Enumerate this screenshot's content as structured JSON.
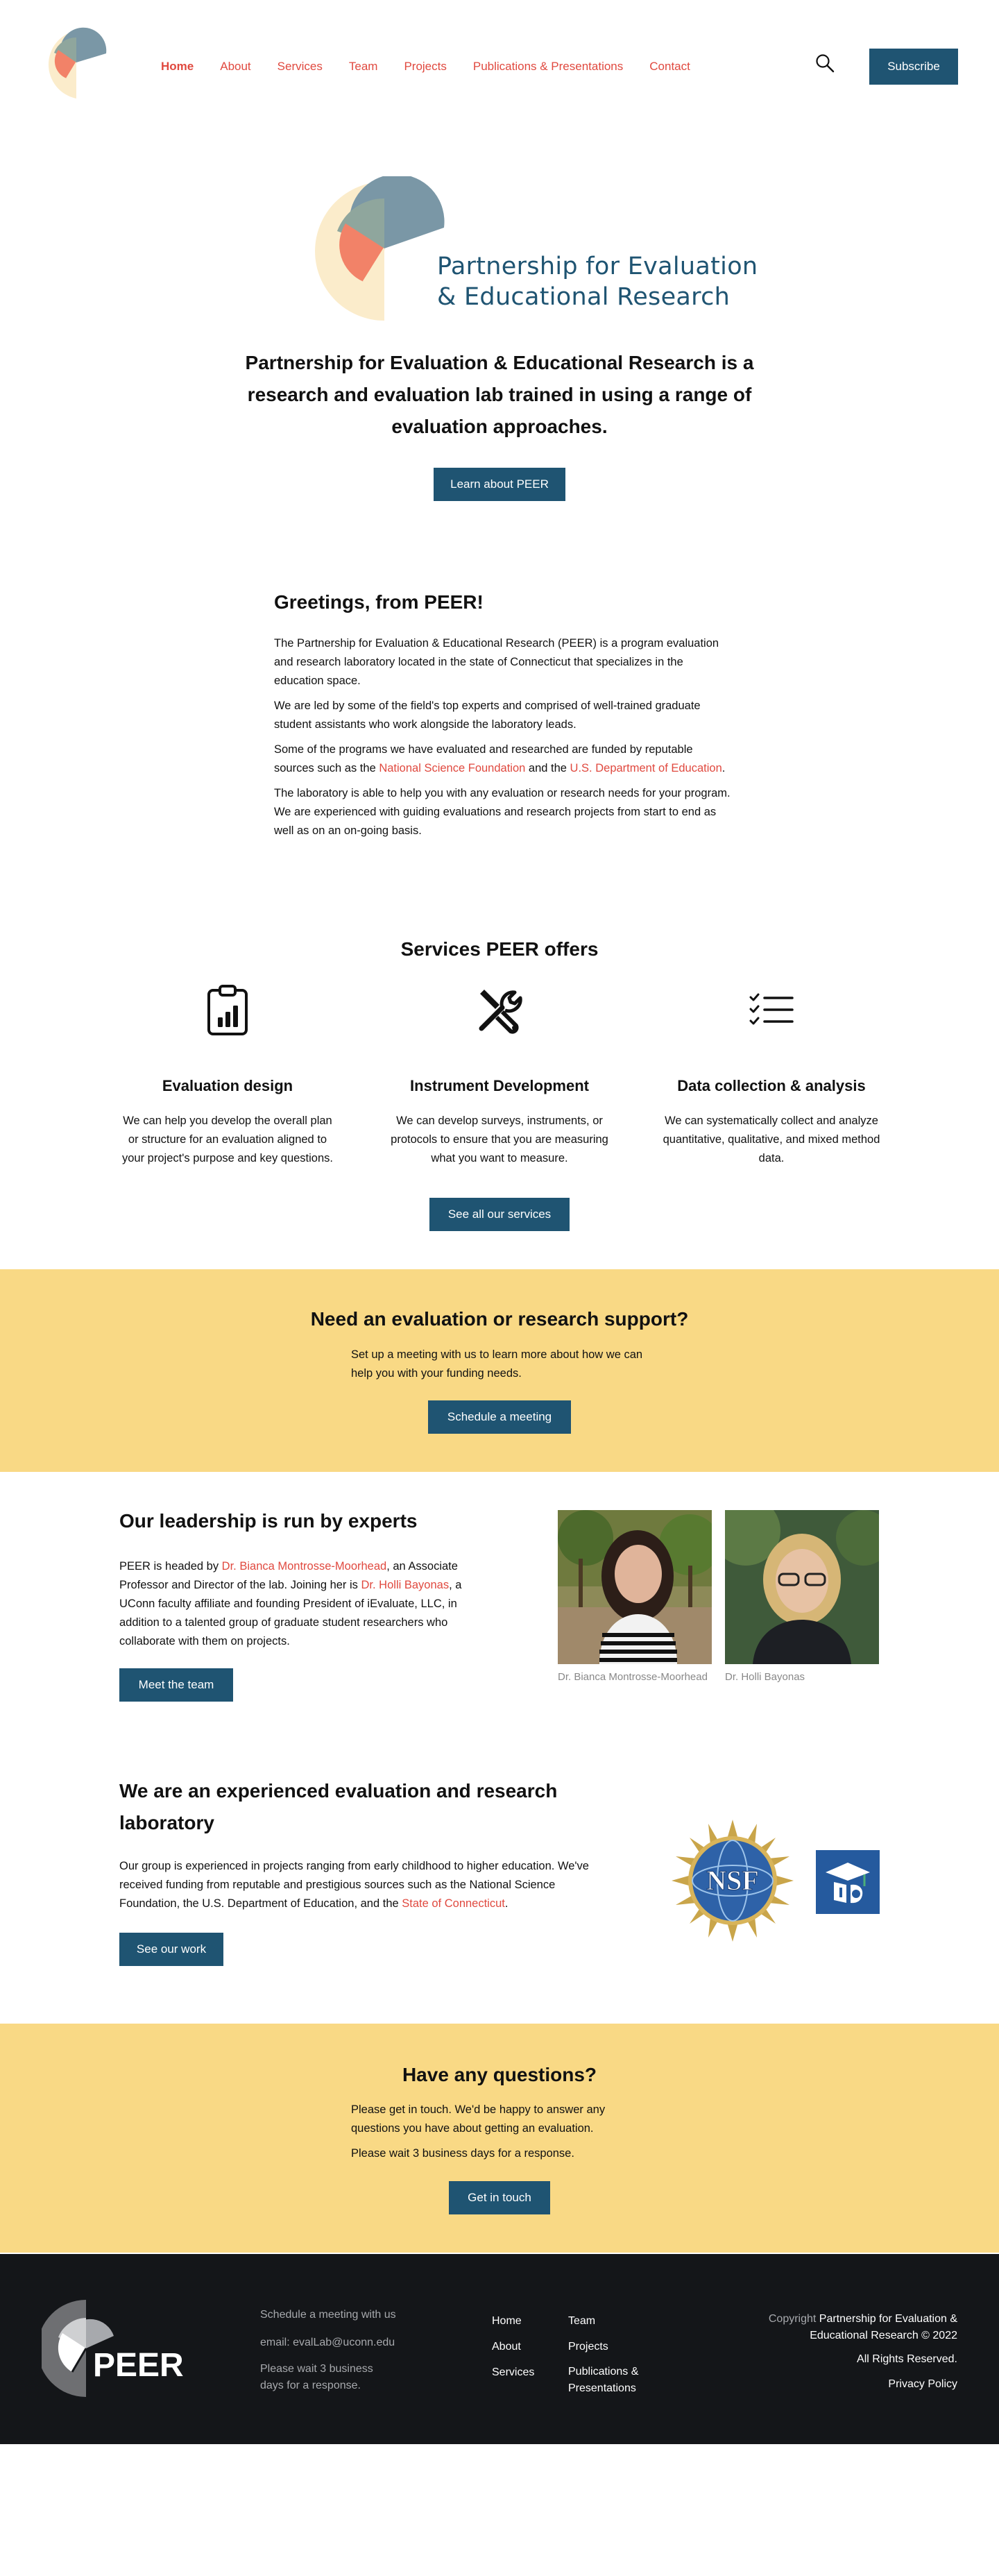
{
  "nav": {
    "items": [
      "Home",
      "About",
      "Services",
      "Team",
      "Projects",
      "Publications & Presentations",
      "Contact"
    ],
    "subscribe": "Subscribe"
  },
  "hero": {
    "brand_line1": "Partnership for Evaluation",
    "brand_line2": "& Educational Research",
    "tagline": "Partnership for Evaluation & Educational Research is a research and evaluation lab trained in using a range of evaluation approaches.",
    "button": "Learn about PEER"
  },
  "greetings": {
    "title": "Greetings, from PEER!",
    "p1": "The Partnership for Evaluation & Educational Research (PEER) is a program evaluation and research laboratory located in the state of Connecticut that specializes in the education space.",
    "p2": "We are led by some of the field's top experts and comprised of well-trained graduate student assistants who work alongside the laboratory leads.",
    "p3_a": "Some of the programs we have evaluated and researched are funded by reputable sources such as the ",
    "p3_link1": "National Science Foundation",
    "p3_b": " and the ",
    "p3_link2": "U.S. Department of Education",
    "p3_c": ".",
    "p4": "The laboratory is able to help you with any evaluation or research needs for your program. We are experienced with guiding evaluations and research projects from start to end as well as on an on-going basis."
  },
  "services": {
    "title": "Services PEER offers",
    "items": [
      {
        "title": "Evaluation design",
        "text": "We can help you develop the overall plan or structure for an evaluation aligned to your project's purpose and key questions.",
        "icon": "clipboard-chart-icon"
      },
      {
        "title": "Instrument Development",
        "text": "We can develop surveys, instruments, or protocols to ensure that you are measuring what you want to measure.",
        "icon": "tools-icon"
      },
      {
        "title": "Data collection & analysis",
        "text": "We can systematically collect and analyze quantitative, qualitative, and mixed method data.",
        "icon": "checklist-icon"
      }
    ],
    "button": "See all our services"
  },
  "cta1": {
    "title": "Need an evaluation or research support?",
    "text": "Set up a meeting with us to learn more about how we can help you with your funding needs.",
    "button": "Schedule a meeting"
  },
  "leadership": {
    "title": "Our leadership is run by experts",
    "p_a": "PEER is headed by ",
    "link1": "Dr. Bianca Montrosse-Moorhead",
    "p_b": ", an Associate Professor and Director of the lab. Joining her is ",
    "link2": "Dr. Holli Bayonas",
    "p_c": ", a UConn faculty affiliate and founding President of iEvaluate, LLC, in addition to a talented group of graduate student researchers who collaborate with them on projects.",
    "button": "Meet the team",
    "captions": [
      "Dr. Bianca Montrosse-Moorhead",
      "Dr. Holli Bayonas"
    ]
  },
  "experience": {
    "title": "We are an experienced evaluation and research laboratory",
    "p_a": "Our group is experienced in projects ranging from early childhood to higher education. We've received funding from reputable and prestigious sources such as the National Science Foundation, the U.S. Department of Education, and the ",
    "link": "State of Connecticut",
    "p_b": ".",
    "button": "See our work",
    "nsf_label": "NSF"
  },
  "cta2": {
    "title": "Have any questions?",
    "text1": "Please get in touch. We'd be happy to answer any questions you have about getting an evaluation.",
    "text2": "Please wait 3 business days for a response.",
    "button": "Get in touch"
  },
  "footer": {
    "logo_text": "PEER",
    "schedule": "Schedule a meeting with us",
    "email": "email: evalLab@uconn.edu",
    "wait": "Please wait 3 business days for a response.",
    "links_col1": [
      "Home",
      "About",
      "Services"
    ],
    "links_col2": [
      "Team",
      "Projects",
      "Publications & Presentations"
    ],
    "copyright_prefix": "Copyright ",
    "copyright_name": "Partnership for Evaluation & Educational Research © 2022",
    "rights": "All Rights Reserved.",
    "privacy": "Privacy Policy"
  }
}
